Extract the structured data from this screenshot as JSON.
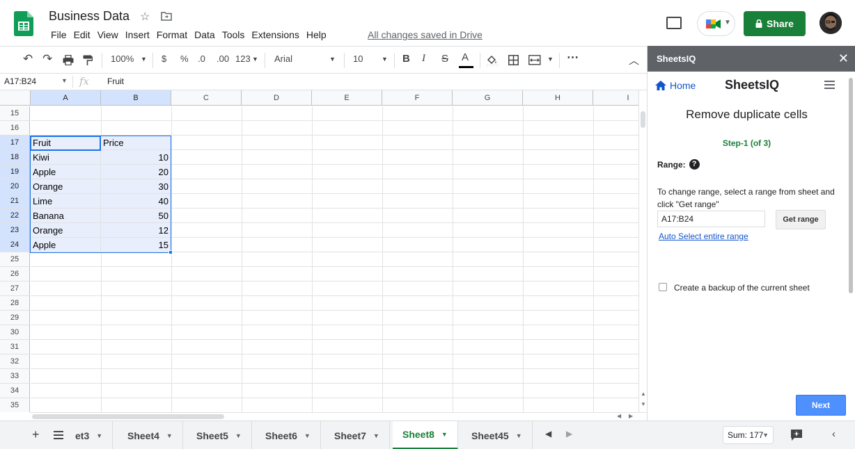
{
  "header": {
    "doc_title": "Business Data",
    "menu": [
      "File",
      "Edit",
      "View",
      "Insert",
      "Format",
      "Data",
      "Tools",
      "Extensions",
      "Help"
    ],
    "saved_status": "All changes saved in Drive",
    "share_label": "Share"
  },
  "toolbar": {
    "zoom": "100%",
    "currency": "$",
    "percent": "%",
    "decrease_decimal": ".0",
    "increase_decimal": ".00",
    "format_more": "123",
    "font": "Arial",
    "font_size": "10",
    "bold": "B",
    "italic": "I",
    "strike": "S",
    "text_color": "A",
    "more": "⋯"
  },
  "formula_bar": {
    "name_box": "A17:B24",
    "fx": "fx",
    "value": "Fruit"
  },
  "grid": {
    "columns": [
      "A",
      "B",
      "C",
      "D",
      "E",
      "F",
      "G",
      "H",
      "I"
    ],
    "rows": [
      "15",
      "16",
      "17",
      "18",
      "19",
      "20",
      "21",
      "22",
      "23",
      "24",
      "25",
      "26",
      "27",
      "28",
      "29",
      "30",
      "31",
      "32",
      "33",
      "34",
      "35"
    ],
    "cells": {
      "a17": "Fruit",
      "b17": "Price",
      "a18": "Kiwi",
      "b18": "10",
      "a19": "Apple",
      "b19": "20",
      "a20": "Orange",
      "b20": "30",
      "a21": "Lime",
      "b21": "40",
      "a22": "Banana",
      "b22": "50",
      "a23": "Orange",
      "b23": "12",
      "a24": "Apple",
      "b24": "15"
    }
  },
  "sheet_tabs": {
    "tabs": [
      "et3",
      "Sheet4",
      "Sheet5",
      "Sheet6",
      "Sheet7",
      "Sheet8",
      "Sheet45"
    ],
    "active": "Sheet8",
    "sum": "Sum: 177"
  },
  "panel": {
    "header_title": "SheetsIQ",
    "close": "✕",
    "home": "Home",
    "brand": "SheetsIQ",
    "title": "Remove duplicate cells",
    "step": "Step-1 (of 3)",
    "range_label": "Range:",
    "help": "?",
    "instructions": "To change range, select a range from sheet and click \"Get range\"",
    "range_value": "A17:B24",
    "get_range": "Get range",
    "auto_select": "Auto Select entire range",
    "backup_label": "Create a backup of the current sheet",
    "next": "Next"
  },
  "colors": {
    "accent_green": "#188038",
    "selection_blue": "#1a73e8",
    "panel_header": "#5f6368",
    "next_button": "#4d90fe"
  }
}
